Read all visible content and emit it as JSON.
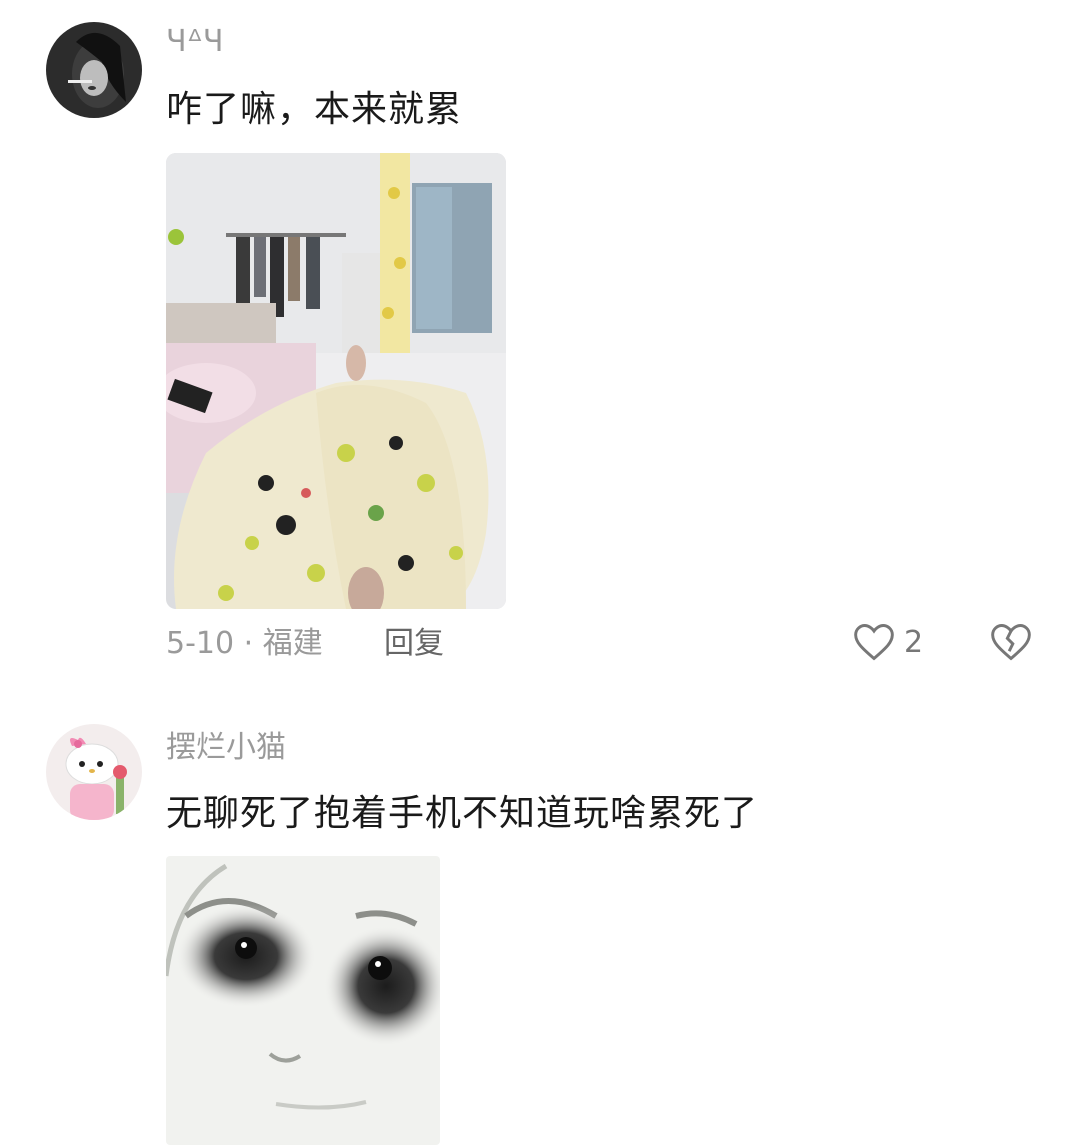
{
  "comments": [
    {
      "username": "ꞍᐞꞍ",
      "text": "咋了嘛，本来就累",
      "date_location": "5-10 · 福建",
      "reply_label": "回复",
      "like_count": "2",
      "avatar_icon": "avatar-icon",
      "image": "photo-bed-pajamas"
    },
    {
      "username": "摆烂小猫",
      "text": "无聊死了抱着手机不知道玩啥累死了",
      "avatar_icon": "avatar-icon",
      "image": "sticker-tired-face"
    }
  ],
  "icons": {
    "like": "heart-icon",
    "dislike": "broken-heart-icon"
  },
  "colors": {
    "meta_gray": "#9a9a9a",
    "text": "#1a1a1a"
  }
}
